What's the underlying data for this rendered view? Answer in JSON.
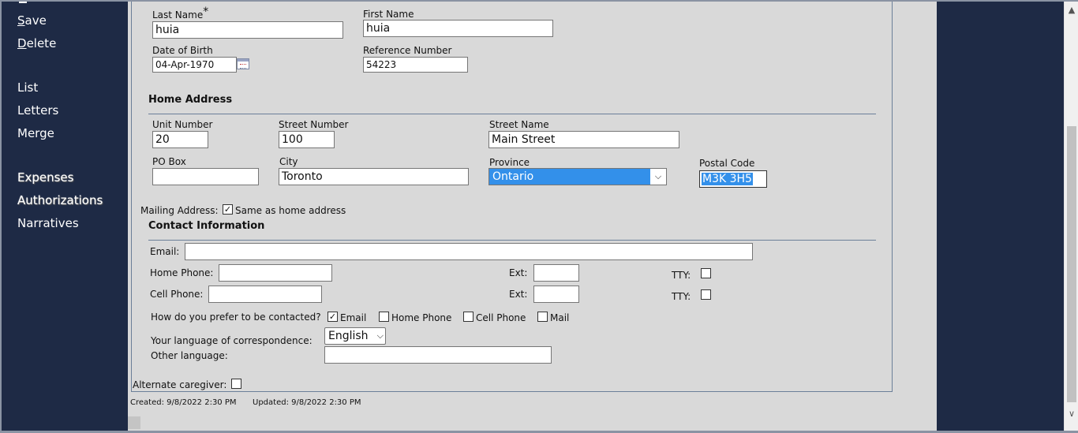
{
  "sidebar": {
    "items": [
      {
        "label": "Save",
        "accel": "S",
        "rest": "ave"
      },
      {
        "label": "Delete",
        "accel": "D",
        "rest": "elete"
      },
      {
        "label": "List"
      },
      {
        "label": "Letters"
      },
      {
        "label": "Merge"
      },
      {
        "label": "Expenses"
      },
      {
        "label": "Authorizations"
      },
      {
        "label": "Narratives"
      }
    ]
  },
  "personal": {
    "last_name_label": "Last Name",
    "required_mark": "*",
    "last_name_value": "huia",
    "first_name_label": "First Name",
    "first_name_value": "huia",
    "dob_label": "Date of Birth",
    "dob_value": "04-Apr-1970",
    "ref_label": "Reference Number",
    "ref_value": "54223"
  },
  "home_address": {
    "title": "Home Address",
    "unit_label": "Unit Number",
    "unit_value": "20",
    "street_number_label": "Street Number",
    "street_number_value": "100",
    "street_name_label": "Street Name",
    "street_name_value": "Main Street",
    "po_box_label": "PO Box",
    "po_box_value": "",
    "city_label": "City",
    "city_value": "Toronto",
    "province_label": "Province",
    "province_value": "Ontario",
    "postal_label": "Postal Code",
    "postal_value": "M3K 3H5"
  },
  "mailing": {
    "label": "Mailing Address:",
    "same_label": "Same as home address",
    "same_checked": true
  },
  "contact": {
    "title": "Contact Information",
    "email_label": "Email:",
    "email_value": "",
    "home_phone_label": "Home Phone:",
    "cell_phone_label": "Cell Phone:",
    "ext_label": "Ext:",
    "tty_label": "TTY:",
    "prefer_label": "How do you prefer to be contacted?",
    "pref_email": "Email",
    "pref_home": "Home Phone",
    "pref_cell": "Cell Phone",
    "pref_mail": "Mail",
    "language_label": "Your language of correspondence:",
    "language_value": "English",
    "other_language_label": "Other language:"
  },
  "alternate_caregiver_label": "Alternate caregiver:",
  "footer": {
    "created": "Created: 9/8/2022 2:30 PM",
    "updated": "Updated: 9/8/2022 2:30 PM"
  },
  "icons": {
    "checkmark": "✓",
    "chevron_down": "⌵",
    "scroll_up": "▲",
    "scroll_down": "∨"
  }
}
